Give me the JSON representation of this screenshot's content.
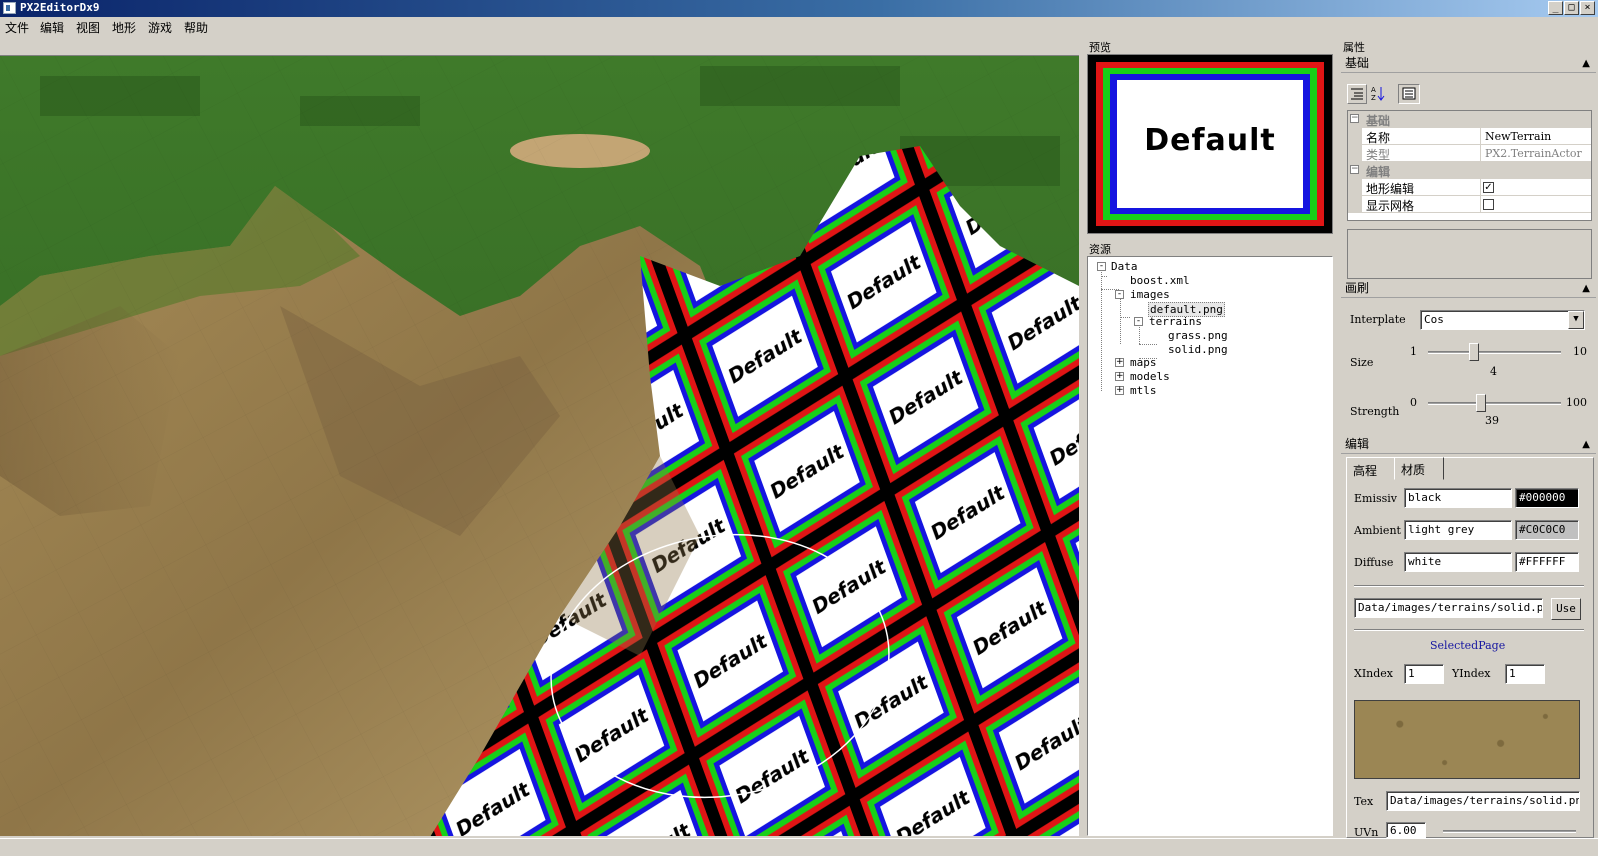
{
  "window": {
    "title": "PX2EditorDx9",
    "min": "_",
    "max": "□",
    "close": "×"
  },
  "menu": [
    "文件",
    "编辑",
    "视图",
    "地形",
    "游戏",
    "帮助"
  ],
  "viewport": {
    "tile_text": "Default"
  },
  "preview": {
    "title": "预览",
    "image_text": "Default"
  },
  "resources": {
    "title": "资源",
    "tree": [
      {
        "label": "Data",
        "toggle": "-"
      },
      {
        "label": "boost.xml"
      },
      {
        "label": "images",
        "toggle": "-"
      },
      {
        "label": "default.png"
      },
      {
        "label": "terrains",
        "toggle": "-"
      },
      {
        "label": "grass.png"
      },
      {
        "label": "solid.png"
      },
      {
        "label": "maps",
        "toggle": "+"
      },
      {
        "label": "models",
        "toggle": "+"
      },
      {
        "label": "mtls",
        "toggle": "+"
      }
    ]
  },
  "properties": {
    "title": "属性",
    "basic_section": "基础",
    "grid": {
      "cat_basic": "基础",
      "name_label": "名称",
      "name_value": "NewTerrain",
      "type_label": "类型",
      "type_value": "PX2.TerrainActor",
      "cat_edit": "编辑",
      "terrain_edit_label": "地形编辑",
      "terrain_edit_checked": true,
      "show_grid_label": "显示网格",
      "show_grid_checked": false
    }
  },
  "brush": {
    "section": "画刷",
    "interplate_label": "Interplate",
    "interplate_value": "Cos",
    "size_label": "Size",
    "size_min": "1",
    "size_max": "10",
    "size_value": "4",
    "size_fraction": 0.33,
    "strength_label": "Strength",
    "strength_min": "0",
    "strength_max": "100",
    "strength_value": "39",
    "strength_fraction": 0.39
  },
  "edit": {
    "section": "编辑",
    "tab_height": "高程",
    "tab_material": "材质",
    "emissive_label": "Emissiv",
    "emissive_value": "black",
    "emissive_hex": "#000000",
    "ambient_label": "Ambient",
    "ambient_value": "light grey",
    "ambient_hex": "#C0C0C0",
    "diffuse_label": "Diffuse",
    "diffuse_value": "white",
    "diffuse_hex": "#FFFFFF",
    "texture_path": "Data/images/terrains/solid.png",
    "use_button": "Use",
    "selected_page": "SelectedPage",
    "xindex_label": "XIndex",
    "xindex_value": "1",
    "yindex_label": "YIndex",
    "yindex_value": "1",
    "tex_label": "Tex",
    "tex_value": "Data/images/terrains/solid.png",
    "uv_label": "UVn",
    "uv_value": "6.00"
  }
}
